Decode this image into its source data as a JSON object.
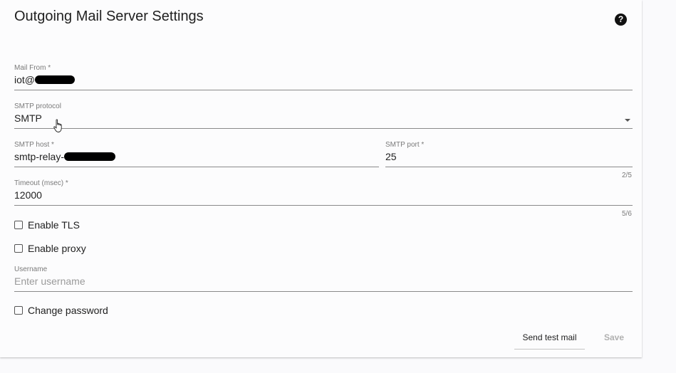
{
  "title": "Outgoing Mail Server Settings",
  "help_icon": "?",
  "fields": {
    "mail_from": {
      "label": "Mail From *",
      "value": "iot@"
    },
    "smtp_protocol": {
      "label": "SMTP protocol",
      "value": "SMTP"
    },
    "smtp_host": {
      "label": "SMTP host *",
      "value": "smtp-relay-"
    },
    "smtp_port": {
      "label": "SMTP port *",
      "value": "25",
      "counter": "2/5"
    },
    "timeout": {
      "label": "Timeout (msec) *",
      "value": "12000",
      "counter": "5/6"
    },
    "username": {
      "label": "Username",
      "placeholder": "Enter username"
    }
  },
  "checkboxes": {
    "enable_tls": {
      "label": "Enable TLS",
      "checked": false
    },
    "enable_proxy": {
      "label": "Enable proxy",
      "checked": false
    },
    "change_password": {
      "label": "Change password",
      "checked": false
    }
  },
  "actions": {
    "send_test_mail": "Send test mail",
    "save": "Save"
  }
}
